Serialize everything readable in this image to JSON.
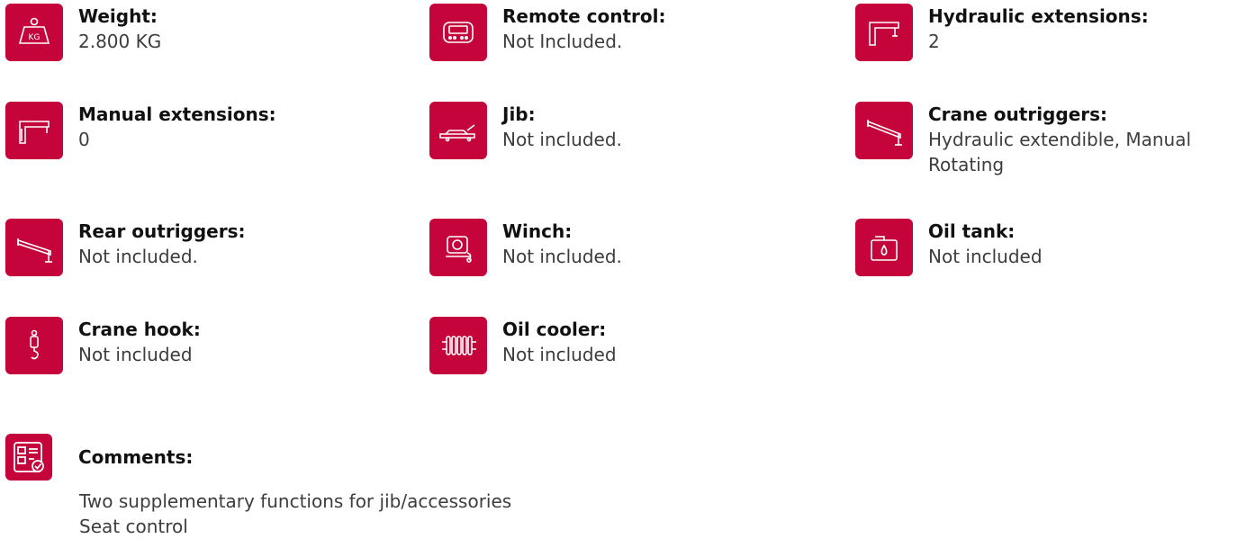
{
  "specs": [
    {
      "label": "Weight:",
      "value": "2.800 KG",
      "icon": "weight-icon"
    },
    {
      "label": "Remote control:",
      "value": "Not Included.",
      "icon": "remote-control-icon"
    },
    {
      "label": "Hydraulic extensions:",
      "value": "2",
      "icon": "hydraulic-extensions-icon"
    },
    {
      "label": "Manual extensions:",
      "value": "0",
      "icon": "manual-extensions-icon"
    },
    {
      "label": "Jib:",
      "value": "Not included.",
      "icon": "jib-icon"
    },
    {
      "label": "Crane outriggers:",
      "value": "Hydraulic extendible, Manual Rotating",
      "icon": "crane-outriggers-icon"
    },
    {
      "label": "Rear outriggers:",
      "value": "Not included.",
      "icon": "rear-outriggers-icon"
    },
    {
      "label": "Winch:",
      "value": "Not included.",
      "icon": "winch-icon"
    },
    {
      "label": "Oil tank:",
      "value": "Not included",
      "icon": "oil-tank-icon"
    },
    {
      "label": "Crane hook:",
      "value": "Not included",
      "icon": "crane-hook-icon"
    },
    {
      "label": "Oil cooler:",
      "value": "Not included",
      "icon": "oil-cooler-icon"
    }
  ],
  "comments": {
    "label": "Comments:",
    "icon": "comments-icon",
    "lines": [
      "Two supplementary functions for jib/accessories",
      "Seat control"
    ]
  },
  "colors": {
    "icon_background": "#c4043a",
    "label_text": "#111111",
    "value_text": "#3d3d3d"
  }
}
